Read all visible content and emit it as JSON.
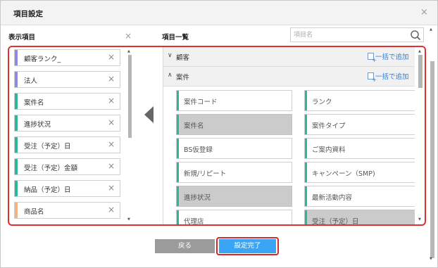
{
  "dialog": {
    "title": "項目設定",
    "close_glyph": "×"
  },
  "left_panel": {
    "label": "表示項目",
    "clear_glyph": "×",
    "items": [
      {
        "label": "顧客ランク_",
        "color": "#8e8be0"
      },
      {
        "label": "法人",
        "color": "#8e8be0"
      },
      {
        "label": "案件名",
        "color": "#2bb69c"
      },
      {
        "label": "進捗状況",
        "color": "#2bb69c"
      },
      {
        "label": "受注（予定）日",
        "color": "#2bb69c"
      },
      {
        "label": "受注（予定）金額",
        "color": "#2bb69c"
      },
      {
        "label": "納品（予定）日",
        "color": "#2bb69c"
      },
      {
        "label": "商品名",
        "color": "#f4b183"
      }
    ],
    "remove_glyph": "×"
  },
  "right_panel": {
    "label": "項目一覧",
    "search_placeholder": "項目名",
    "sections": [
      {
        "name": "顧客",
        "chevron": "∨",
        "expanded": false,
        "add_all": "一括で追加"
      },
      {
        "name": "案件",
        "chevron": "∧",
        "expanded": true,
        "add_all": "一括で追加"
      }
    ],
    "candidates": [
      {
        "label": "案件コード",
        "selected": false
      },
      {
        "label": "ランク",
        "selected": false
      },
      {
        "label": "案件名",
        "selected": true
      },
      {
        "label": "案件タイプ",
        "selected": false
      },
      {
        "label": "BS仮登録",
        "selected": false
      },
      {
        "label": "ご案内資料",
        "selected": false
      },
      {
        "label": "新規/リピート",
        "selected": false
      },
      {
        "label": "キャンペーン（SMP)",
        "selected": false
      },
      {
        "label": "進捗状況",
        "selected": true
      },
      {
        "label": "最新活動内容",
        "selected": false
      },
      {
        "label": "代理店",
        "selected": false
      },
      {
        "label": "受注（予定）日",
        "selected": true
      }
    ]
  },
  "buttons": {
    "back": "戻る",
    "done": "設定完了"
  },
  "colors": {
    "accent_blue": "#3ba5f5",
    "highlight_red": "#e03030",
    "case_bar": "#2bb69c"
  },
  "icons": {
    "search": "search-icon",
    "move_left": "arrow-left-icon",
    "add_all": "add-all-icon"
  }
}
